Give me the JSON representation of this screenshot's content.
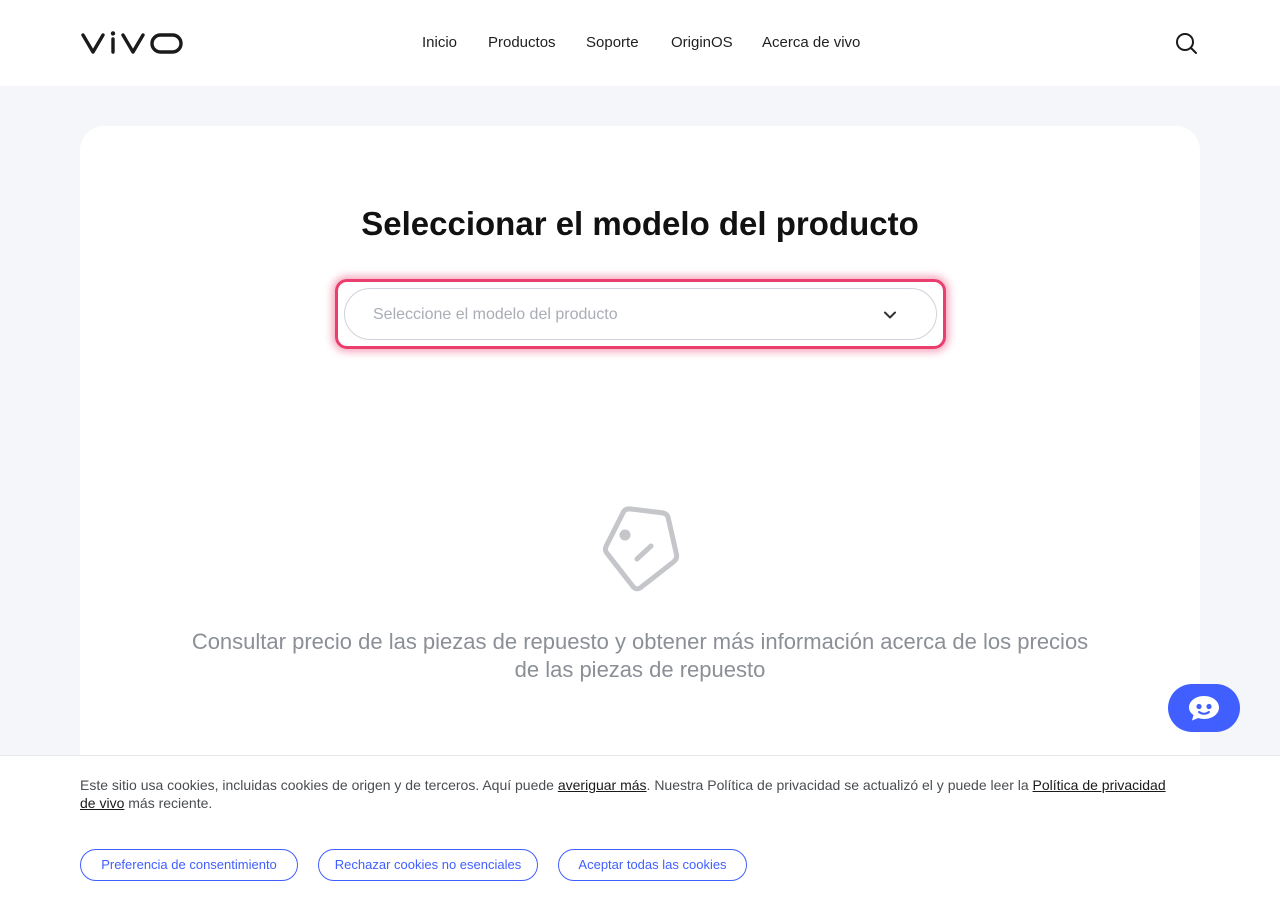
{
  "header": {
    "logo_text": "vivo",
    "nav": [
      {
        "label": "Inicio"
      },
      {
        "label": "Productos"
      },
      {
        "label": "Soporte"
      },
      {
        "label": "OriginOS"
      },
      {
        "label": "Acerca de vivo"
      }
    ],
    "search_icon": "search-icon"
  },
  "main": {
    "title": "Seleccionar el modelo del producto",
    "select": {
      "placeholder": "Seleccione el modelo del producto",
      "icon": "chevron-down-icon"
    },
    "empty_state": {
      "icon": "price-tag-icon",
      "text": "Consultar precio de las piezas de repuesto y obtener más información acerca de los precios de las piezas de repuesto"
    }
  },
  "chat": {
    "icon": "chat-bot-icon"
  },
  "cookies": {
    "text_1": "Este sitio usa cookies, incluidas cookies de origen y de terceros. Aquí puede ",
    "link_1": "averiguar más",
    "text_2": ". Nuestra Política de privacidad se actualizó el y puede leer la ",
    "link_2": "Política de privacidad de vivo",
    "text_3": " más reciente.",
    "buttons": [
      {
        "label": "Preferencia de consentimiento"
      },
      {
        "label": "Rechazar cookies no esenciales"
      },
      {
        "label": "Aceptar todas las cookies"
      }
    ]
  },
  "colors": {
    "accent": "#415fff",
    "focus": "#ea3f6e",
    "page_bg": "#f4f6fa"
  }
}
